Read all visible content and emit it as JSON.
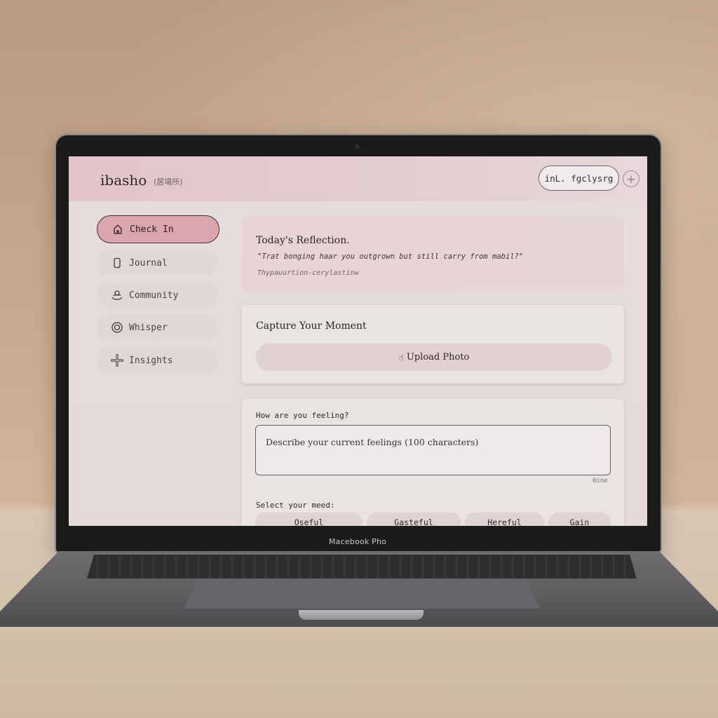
{
  "app": {
    "brand": "ibasho",
    "brand_sub": "(居場所)",
    "language_button": "inL. fgclysrg",
    "add_button": "+"
  },
  "sidebar": {
    "items": [
      {
        "label": "Check In",
        "icon": "home-icon",
        "active": true
      },
      {
        "label": "Journal",
        "icon": "phone-icon",
        "active": false
      },
      {
        "label": "Community",
        "icon": "community-icon",
        "active": false
      },
      {
        "label": "Whisper",
        "icon": "whisper-icon",
        "active": false
      },
      {
        "label": "Insights",
        "icon": "sparkle-icon",
        "active": false
      }
    ]
  },
  "reflection": {
    "title": "Today's Reflection.",
    "quote": "\"Trat bonging haar you outgrown but still carry from mabil?\"",
    "source": "Thypauurtion-cerylastinw"
  },
  "capture": {
    "title": "Capture Your Moment",
    "upload_label": "Upload Photo",
    "upload_icon": "hand-pointer-icon"
  },
  "feeling": {
    "question": "How are you feeling?",
    "placeholder": "Describe your current feelings (100 characters)",
    "counter": "0ine",
    "mood_label": "Select your meed:",
    "moods": [
      "Oseful",
      "Gasteful",
      "Hereful",
      "Gain"
    ]
  },
  "device": {
    "label": "Macebook Pho"
  },
  "colors": {
    "accent": "#dba6ab",
    "topbar": "#e2c5c9",
    "card": "#e9e3e2"
  }
}
